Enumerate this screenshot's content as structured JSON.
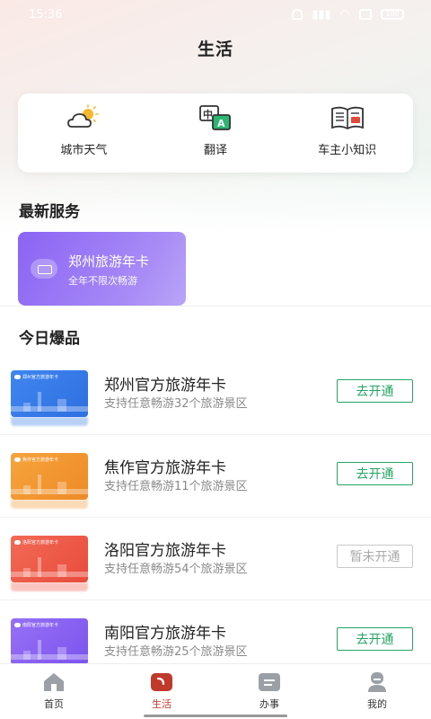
{
  "status_bar": {
    "time": "15:36",
    "battery": "100"
  },
  "page": {
    "title": "生活"
  },
  "quick_actions": [
    {
      "label": "城市天气",
      "icon": "weather-cloud-sun-icon"
    },
    {
      "label": "翻译",
      "icon": "translate-icon"
    },
    {
      "label": "车主小知识",
      "icon": "book-icon"
    }
  ],
  "sections": {
    "latest": "最新服务",
    "hot": "今日爆品"
  },
  "service_card": {
    "title": "郑州旅游年卡",
    "subtitle": "全年不限次畅游",
    "icon": "card-icon"
  },
  "products": [
    {
      "title": "郑州官方旅游年卡",
      "subtitle": "支持任意畅游32个旅游景区",
      "button": "去开通",
      "enabled": true,
      "thumb_label": "郑州官方旅游年卡",
      "thumb_color": "#3d7de8"
    },
    {
      "title": "焦作官方旅游年卡",
      "subtitle": "支持任意畅游11个旅游景区",
      "button": "去开通",
      "enabled": true,
      "thumb_label": "焦作官方旅游年卡",
      "thumb_color": "#f39a34"
    },
    {
      "title": "洛阳官方旅游年卡",
      "subtitle": "支持任意畅游54个旅游景区",
      "button": "暂未开通",
      "enabled": false,
      "thumb_label": "洛阳官方旅游年卡",
      "thumb_color": "#ef5a4a"
    },
    {
      "title": "南阳官方旅游年卡",
      "subtitle": "支持任意畅游25个旅游景区",
      "button": "去开通",
      "enabled": true,
      "thumb_label": "南阳官方旅游年卡",
      "thumb_color": "#8a63f4"
    }
  ],
  "tabbar": [
    {
      "label": "首页",
      "icon": "home-icon",
      "active": false
    },
    {
      "label": "生活",
      "icon": "life-icon",
      "active": true
    },
    {
      "label": "办事",
      "icon": "service-icon",
      "active": false
    },
    {
      "label": "我的",
      "icon": "profile-icon",
      "active": false
    }
  ],
  "colors": {
    "accent_green": "#23a565",
    "active_red": "#c0392b",
    "card_purple": "#8a63f4"
  }
}
